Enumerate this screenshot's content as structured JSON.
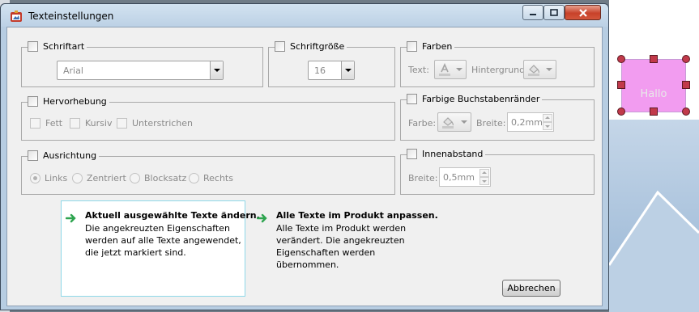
{
  "window": {
    "title": "Texteinstellungen"
  },
  "groups": {
    "font": {
      "label": "Schriftart",
      "value": "Arial"
    },
    "size": {
      "label": "Schriftgröße",
      "value": "16"
    },
    "colors": {
      "label": "Farben",
      "text_label": "Text:",
      "bg_label": "Hintergrund"
    },
    "emphasis": {
      "label": "Hervorhebung",
      "options": [
        "Fett",
        "Kursiv",
        "Unterstrichen"
      ]
    },
    "outline": {
      "label": "Farbige Buchstabenränder",
      "color_label": "Farbe:",
      "width_label": "Breite:",
      "width_value": "0,2mm"
    },
    "alignment": {
      "label": "Ausrichtung",
      "options": [
        "Links",
        "Zentriert",
        "Blocksatz",
        "Rechts"
      ],
      "selected": "Links"
    },
    "padding": {
      "label": "Innenabstand",
      "width_label": "Breite:",
      "width_value": "0,5mm"
    }
  },
  "actions": {
    "selected": {
      "title": "Aktuell ausgewählte Texte ändern.",
      "lines": [
        "Die angekreuzten Eigenschaften",
        "werden auf alle Texte angewendet,",
        "die jetzt markiert sind."
      ]
    },
    "all": {
      "title": "Alle Texte im Produkt anpassen.",
      "lines": [
        "Alle Texte im Produkt werden",
        "verändert. Die angekreuzten",
        "Eigenschaften werden",
        "übernommen."
      ]
    }
  },
  "buttons": {
    "cancel": "Abbrechen"
  },
  "canvas": {
    "sample_text": "Hallo"
  },
  "colors": {
    "accent_arrow": "#2ea44f",
    "shape_fill": "#f29cf0",
    "handle": "#c1394a"
  }
}
